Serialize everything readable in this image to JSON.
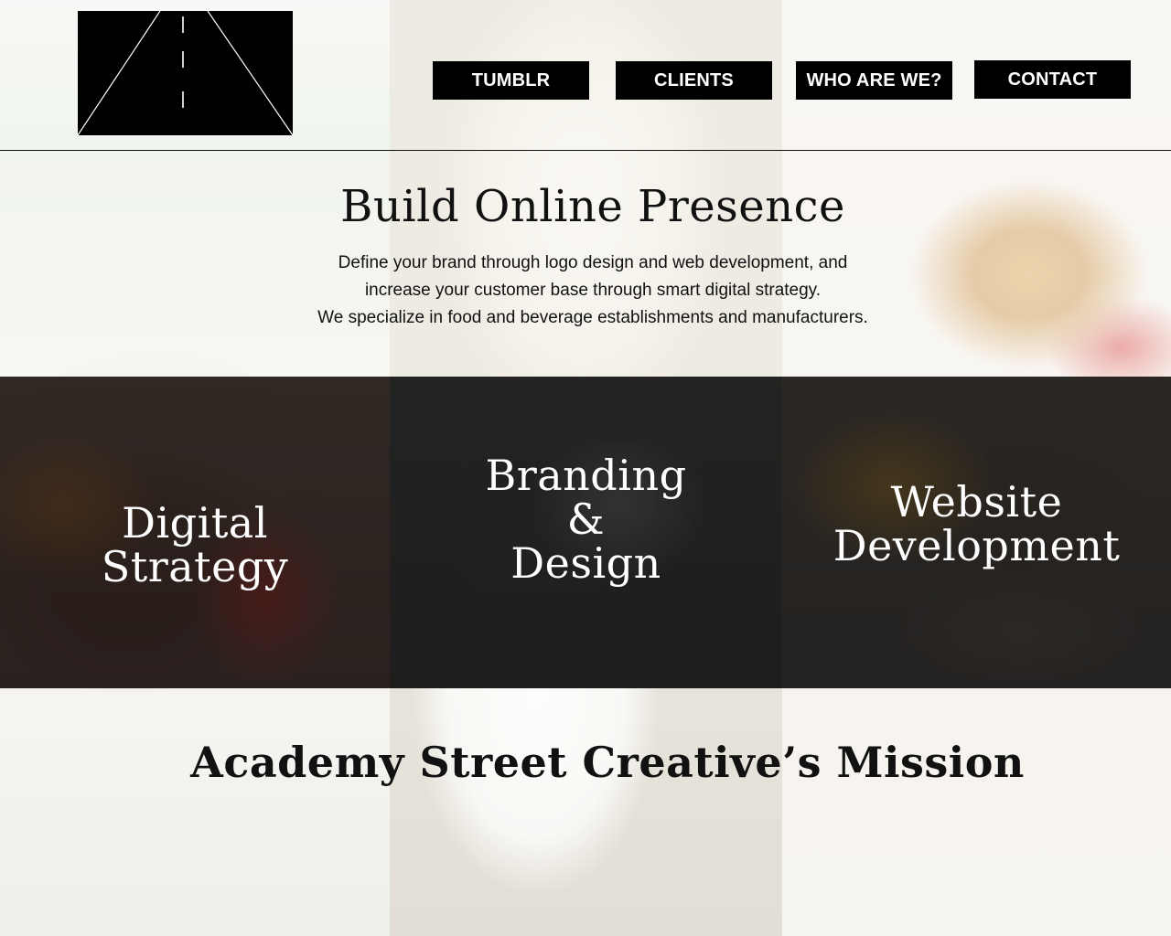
{
  "nav": {
    "items": [
      {
        "label": "TUMBLR"
      },
      {
        "label": "CLIENTS"
      },
      {
        "label": "WHO ARE WE?"
      },
      {
        "label": "CONTACT"
      }
    ]
  },
  "hero": {
    "title": "Build Online Presence",
    "lines": [
      "Define your brand through logo design and web development, and",
      "increase your customer base through smart digital strategy.",
      "We specialize in food and beverage establishments and manufacturers."
    ]
  },
  "services": [
    {
      "lines": [
        "Digital",
        "Strategy"
      ]
    },
    {
      "lines": [
        "Branding",
        "&",
        "Design"
      ]
    },
    {
      "lines": [
        "Website",
        "Development"
      ]
    }
  ],
  "mission": {
    "title": "Academy Street Creative’s Mission"
  },
  "colors": {
    "nav_bg": "#000000",
    "nav_text": "#ffffff",
    "heading_text": "#111111",
    "service_text": "#ffffff"
  },
  "icons": {
    "logo": "road-perspective-logo"
  }
}
